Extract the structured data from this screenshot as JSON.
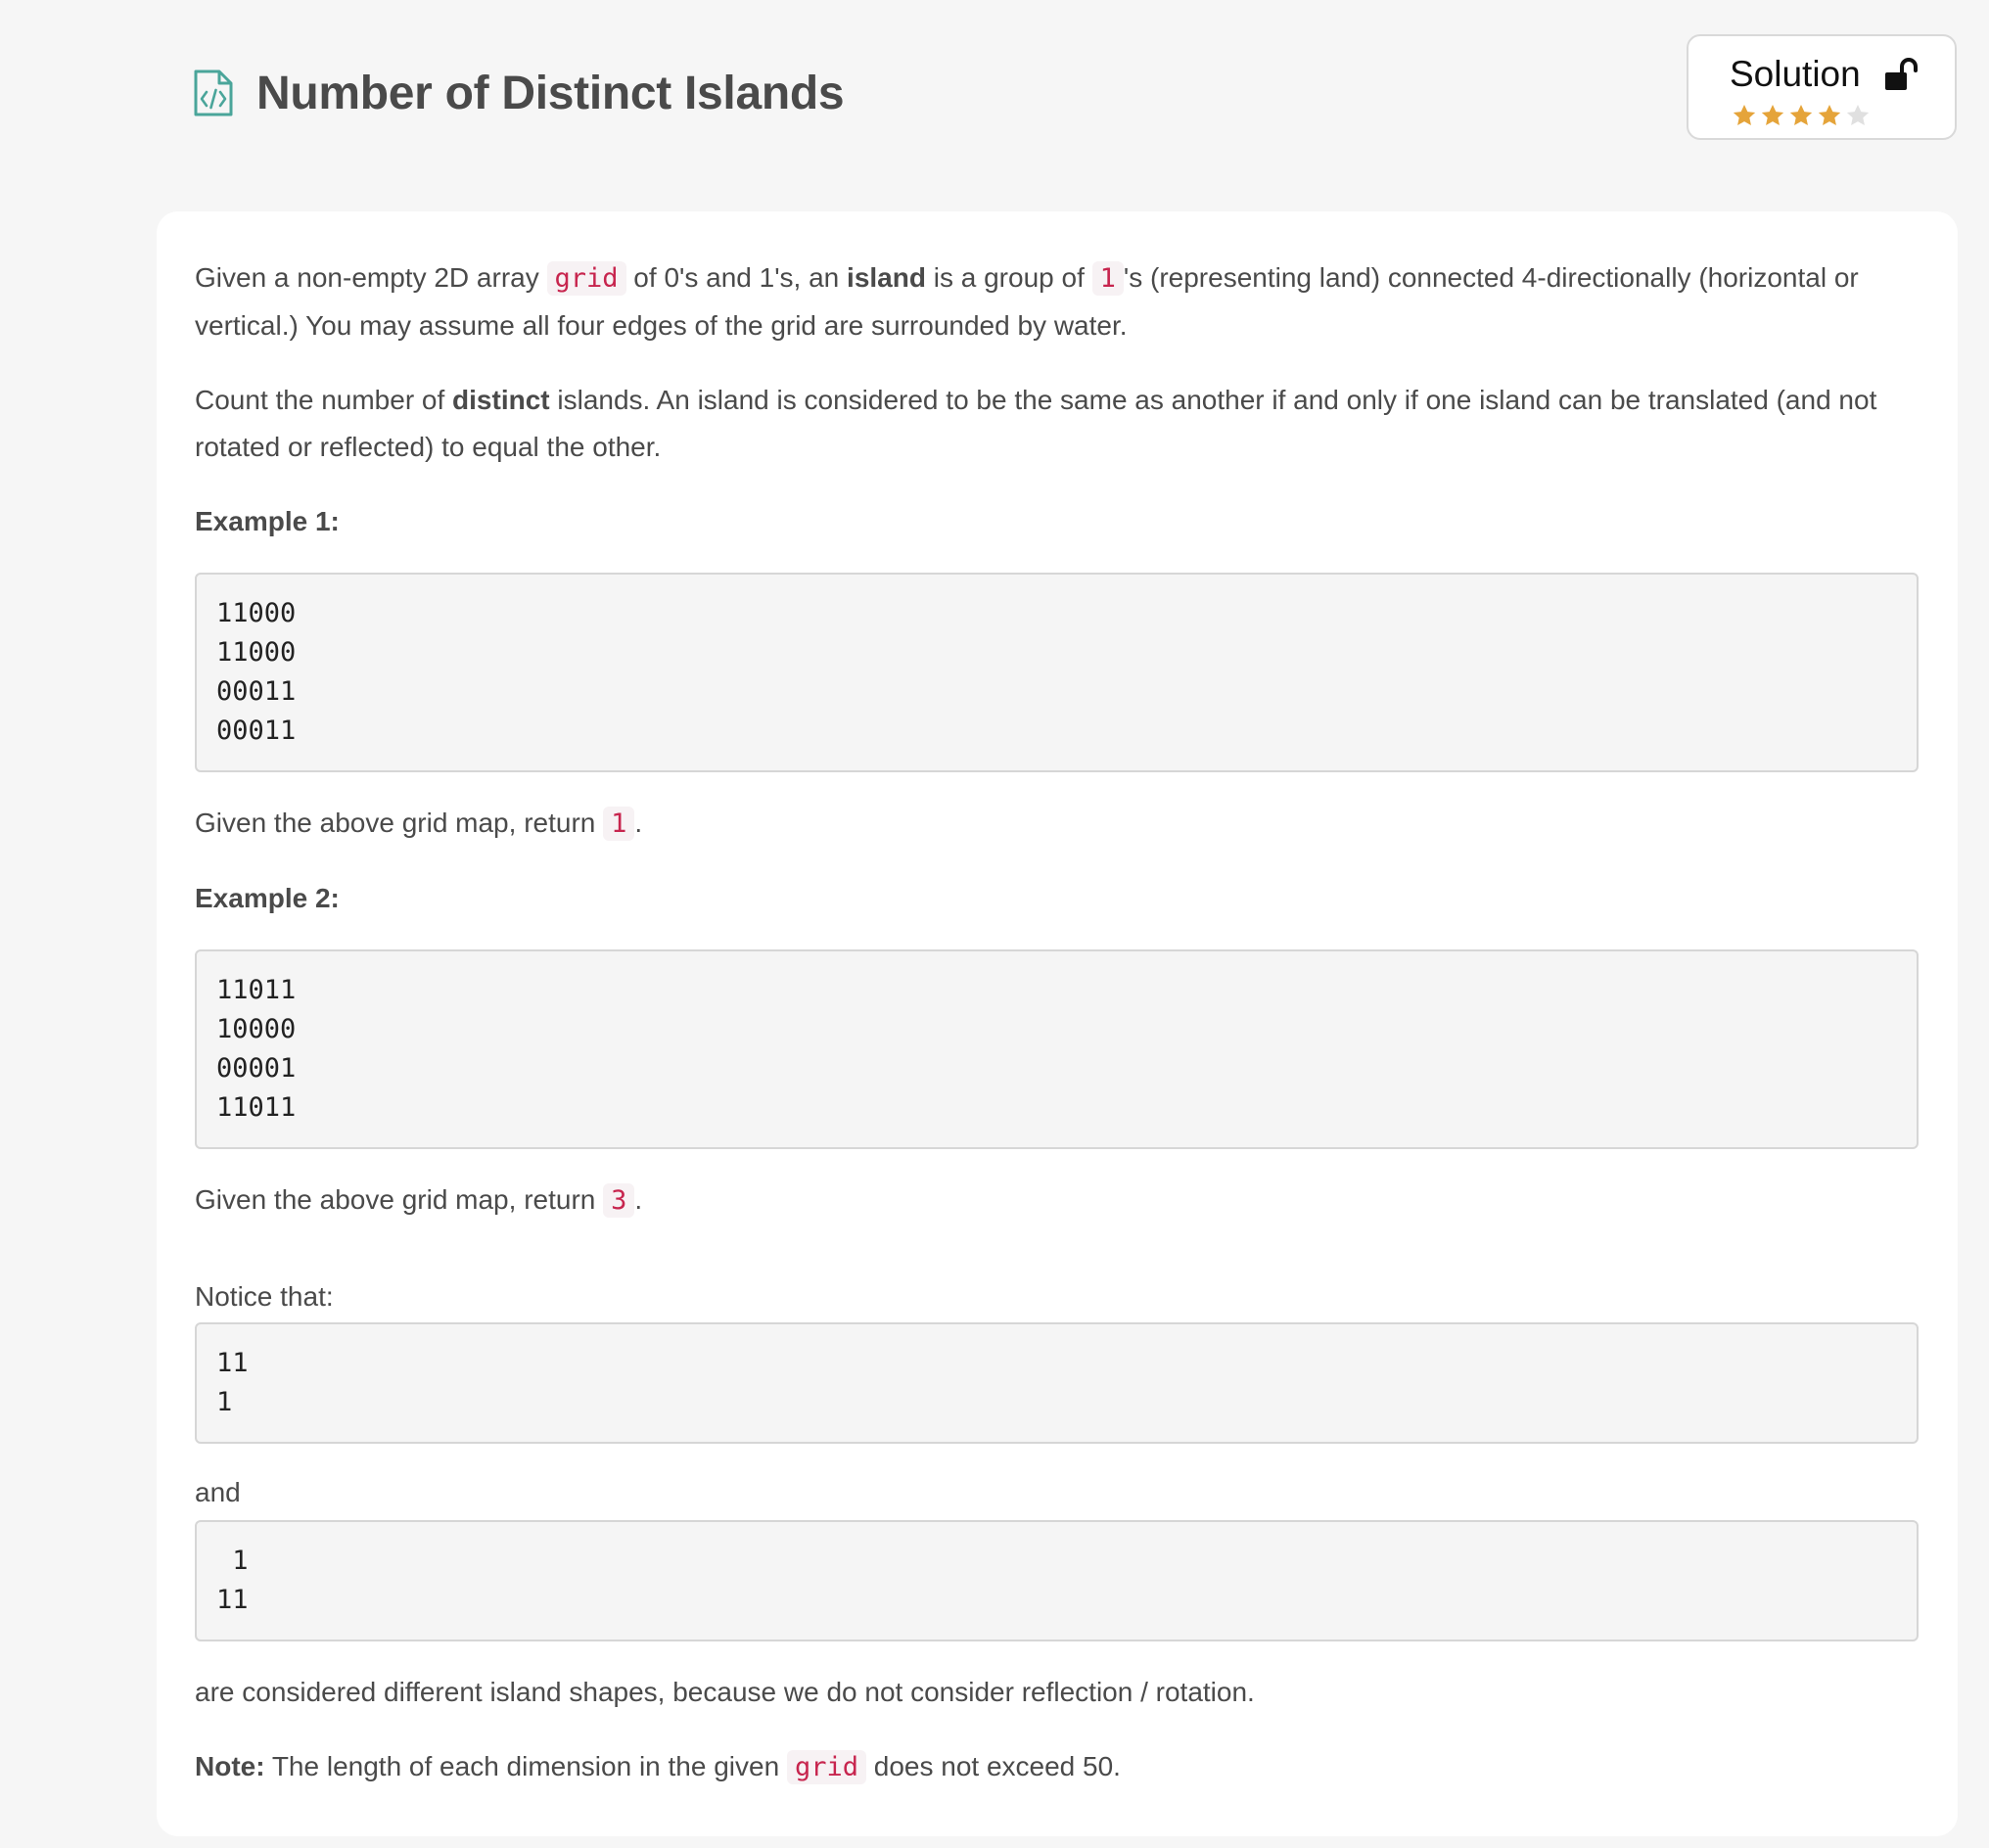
{
  "header": {
    "title": "Number of Distinct Islands",
    "icon": "code-file-icon"
  },
  "solution": {
    "label": "Solution",
    "lock_icon": "unlock-icon",
    "rating": 4,
    "rating_max": 5,
    "star_color": "#e5a43a",
    "star_empty_color": "#e0e0e0"
  },
  "problem": {
    "p1": {
      "t1": "Given a non-empty 2D array ",
      "code1": "grid",
      "t2": " of 0's and 1's, an ",
      "bold1": "island",
      "t3": " is a group of ",
      "code2": "1",
      "t4": "'s (representing land) connected 4-directionally (horizontal or vertical.) You may assume all four edges of the grid are surrounded by water."
    },
    "p2": {
      "t1": "Count the number of ",
      "bold1": "distinct",
      "t2": " islands. An island is considered to be the same as another if and only if one island can be translated (and not rotated or reflected) to equal the other."
    },
    "example1": {
      "heading": "Example 1:",
      "grid": "11000\n11000\n00011\n00011",
      "result_prefix": "Given the above grid map, return ",
      "result_value": "1",
      "result_suffix": "."
    },
    "example2": {
      "heading": "Example 2:",
      "grid": "11011\n10000\n00001\n11011",
      "result_prefix": "Given the above grid map, return ",
      "result_value": "3",
      "result_suffix": "."
    },
    "notice": {
      "label": "Notice that:",
      "shape1": "11\n1",
      "and_label": "and",
      "shape2": " 1\n11",
      "conclusion": "are considered different island shapes, because we do not consider reflection / rotation."
    },
    "note": {
      "label": "Note:",
      "t1": " The length of each dimension in the given ",
      "code1": "grid",
      "t2": " does not exceed 50."
    }
  }
}
